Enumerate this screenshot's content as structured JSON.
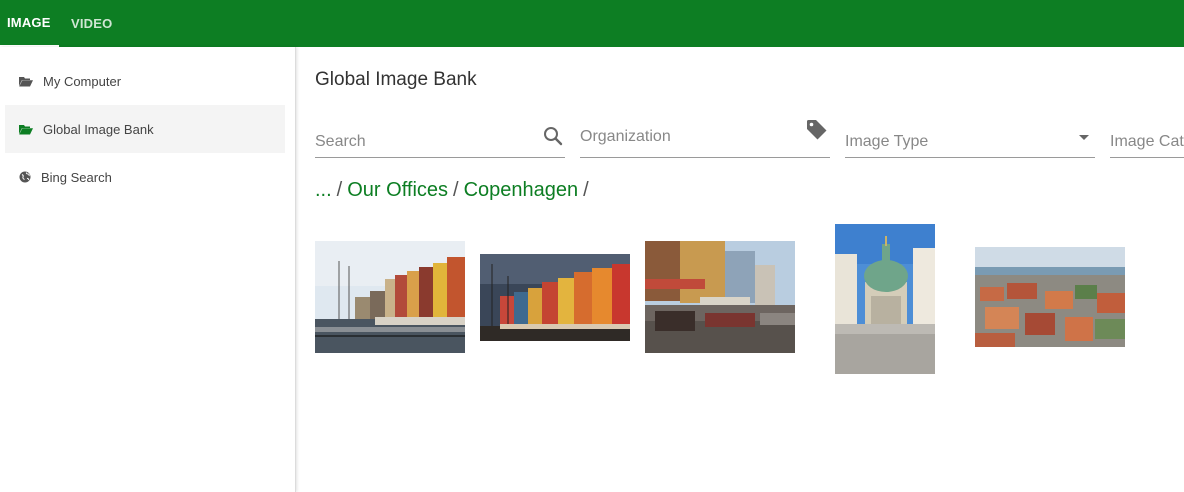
{
  "tabs": [
    {
      "label": "IMAGE",
      "active": true
    },
    {
      "label": "VIDEO",
      "active": false
    }
  ],
  "sidebar": {
    "items": [
      {
        "label": "My Computer",
        "icon": "folder-open-icon",
        "selected": false
      },
      {
        "label": "Global Image Bank",
        "icon": "folder-open-icon",
        "selected": true
      },
      {
        "label": "Bing Search",
        "icon": "globe-icon",
        "selected": false
      }
    ]
  },
  "main": {
    "title": "Global Image Bank",
    "filters": {
      "search_placeholder": "Search",
      "organization_placeholder": "Organization",
      "image_type_placeholder": "Image Type",
      "image_category_placeholder": "Image Cat"
    },
    "breadcrumb": {
      "root": "...",
      "items": [
        "Our Offices",
        "Copenhagen"
      ],
      "separator": "/"
    },
    "thumbnails": [
      {
        "subject": "Nyhavn harbour colorful houses"
      },
      {
        "subject": "Nyhavn under stormy sky"
      },
      {
        "subject": "Nyhavn cafe street"
      },
      {
        "subject": "Frederik's Church dome"
      },
      {
        "subject": "Copenhagen rooftops aerial"
      }
    ]
  },
  "colors": {
    "brand_green": "#0d7e23",
    "selected_bg": "#f4f4f4"
  }
}
